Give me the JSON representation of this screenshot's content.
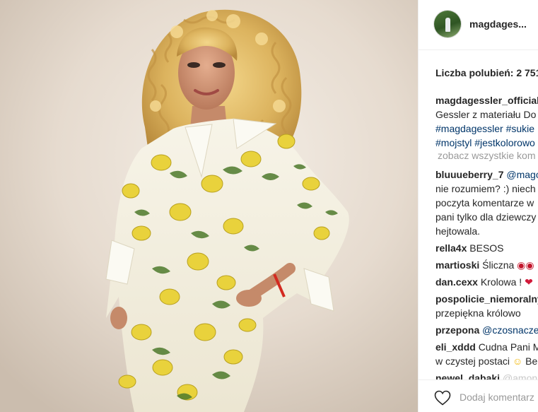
{
  "post": {
    "username": "magdages...",
    "likes": "Liczba polubień: 2 751",
    "caption": {
      "author": "magdagessler_official",
      "line2": "Gessler z materiału Do",
      "line3": "#magdagessler #sukie",
      "line4": "#mojstyl #jestkolorowo"
    },
    "see_all_comments": "zobacz wszystkie kom",
    "comments": [
      {
        "user": "bluuueberry_7",
        "lines": [
          "@mago",
          "nie rozumiem? :) niech",
          "poczyta komentarze w",
          "pani tylko dla dziewczy",
          "hejtowala."
        ]
      },
      {
        "user": "rella4x",
        "text": "BESOS"
      },
      {
        "user": "martioski",
        "text": "Śliczna",
        "emoji": "lips-icon"
      },
      {
        "user": "dan.cexx",
        "text": "Krolowa !",
        "emoji": "heart-icon"
      },
      {
        "user": "pospolicie_niemoralny",
        "lines": [
          "przepiękna królowo"
        ]
      },
      {
        "user": "przepona",
        "text": "@czosnacze"
      },
      {
        "user": "eli_xddd",
        "text": "Cudna Pani M",
        "lines": [
          "w czystej postaci",
          "Be"
        ],
        "emoji": "smiling-face-icon"
      },
      {
        "user": "newel_dabaki",
        "text": "@amon"
      }
    ],
    "add_comment_placeholder": "Dodaj komentarz",
    "colors": {
      "hashtag": "#003569",
      "username": "#262626",
      "muted": "#999999",
      "lips_emoji": "#c2152b"
    }
  }
}
